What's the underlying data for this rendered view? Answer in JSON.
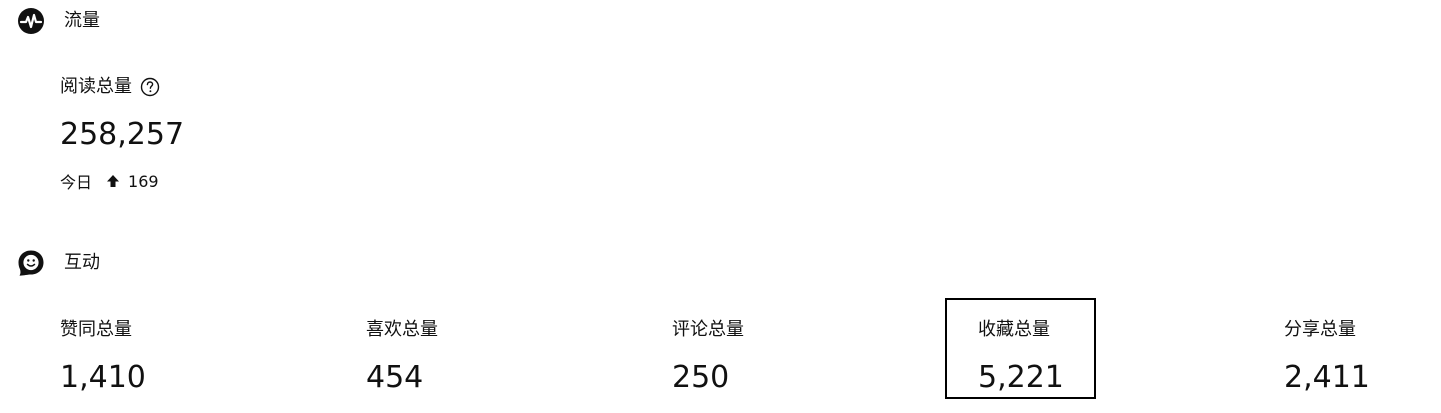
{
  "traffic": {
    "title": "流量",
    "icon": "pulse-icon",
    "read_total": {
      "label": "阅读总量",
      "help_icon": "question-circle-icon",
      "value": "258,257",
      "today_label": "今日",
      "today_trend_icon": "arrow-up-icon",
      "today_value": "169"
    }
  },
  "interaction": {
    "title": "互动",
    "icon": "smile-chat-icon",
    "stats": [
      {
        "label": "赞同总量",
        "value": "1,410"
      },
      {
        "label": "喜欢总量",
        "value": "454"
      },
      {
        "label": "评论总量",
        "value": "250"
      },
      {
        "label": "收藏总量",
        "value": "5,221",
        "highlighted": true
      },
      {
        "label": "分享总量",
        "value": "2,411"
      }
    ]
  }
}
